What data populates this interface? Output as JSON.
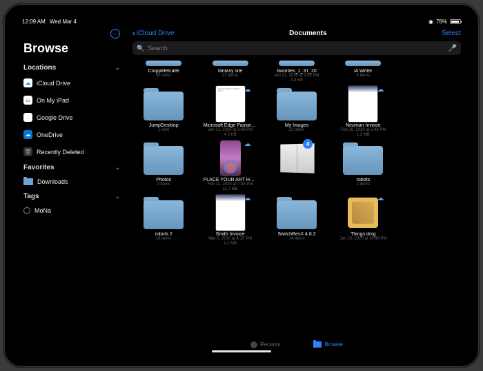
{
  "statusbar": {
    "time": "12:09 AM",
    "date": "Wed Mar 4",
    "battery": "76%"
  },
  "sidebar": {
    "title": "Browse",
    "sections": {
      "locations": {
        "label": "Locations",
        "items": [
          {
            "label": "iCloud Drive"
          },
          {
            "label": "On My iPad"
          },
          {
            "label": "Google Drive"
          },
          {
            "label": "OneDrive"
          },
          {
            "label": "Recently Deleted"
          }
        ]
      },
      "favorites": {
        "label": "Favorites",
        "items": [
          {
            "label": "Downloads"
          }
        ]
      },
      "tags": {
        "label": "Tags",
        "items": [
          {
            "label": "MoNa"
          }
        ]
      }
    }
  },
  "content": {
    "back": "iCloud Drive",
    "title": "Documents",
    "select": "Select",
    "search": "Search",
    "items": [
      {
        "name": "CroppMetcalfe",
        "meta1": "30 items",
        "type": "folder-cut"
      },
      {
        "name": "fantasy site",
        "meta1": "37 items",
        "type": "folder-cut"
      },
      {
        "name": "favorites_1_31_20",
        "meta1": "Jan 31, 2020 at 3:42 PM",
        "meta2": "4.3 KB",
        "type": "folder-cut"
      },
      {
        "name": "iA Writer",
        "meta1": "0 items",
        "type": "folder-cut"
      },
      {
        "name": "",
        "meta1": "",
        "type": "blank"
      },
      {
        "name": "JumpDesktop",
        "meta1": "1 item",
        "type": "folder"
      },
      {
        "name": "Microsoft Edge Passwords",
        "meta1": "Jan 31, 2020 at 3:43 PM",
        "meta2": "4.3 KB",
        "type": "doc",
        "cloud": true
      },
      {
        "name": "My Images",
        "meta1": "22 items",
        "type": "folder"
      },
      {
        "name": "Neuman Invoice",
        "meta1": "Feb 26, 2020 at 5:46 PM",
        "meta2": "1.2 MB",
        "type": "doc-blue",
        "cloud": true
      },
      {
        "name": "",
        "meta1": "",
        "type": "blank"
      },
      {
        "name": "Photos",
        "meta1": "2 items",
        "type": "folder"
      },
      {
        "name": "PLACE YOUR ART HE…",
        "meta1": "Feb 11, 2020 at 7:39 PM",
        "meta2": "11.7 MB",
        "type": "phone",
        "cloud": true
      },
      {
        "name": "",
        "meta1": "",
        "type": "book",
        "badge": "4"
      },
      {
        "name": "robots",
        "meta1": "2 items",
        "type": "folder"
      },
      {
        "name": "",
        "meta1": "",
        "type": "blank"
      },
      {
        "name": "robots 2",
        "meta1": "18 items",
        "type": "folder"
      },
      {
        "name": "Smith Invoice",
        "meta1": "Mar 2, 2020 at 4:15 PM",
        "meta2": "1.1 MB",
        "type": "doc-blue",
        "cloud": true
      },
      {
        "name": "SwitchResX 4.8.2",
        "meta1": "14 items",
        "type": "folder"
      },
      {
        "name": "Things.dmg",
        "meta1": "Jan 20, 2020 at 10:49 PM",
        "type": "dmg",
        "cloud": true
      }
    ]
  },
  "tabs": {
    "recents": "Recents",
    "browse": "Browse"
  }
}
